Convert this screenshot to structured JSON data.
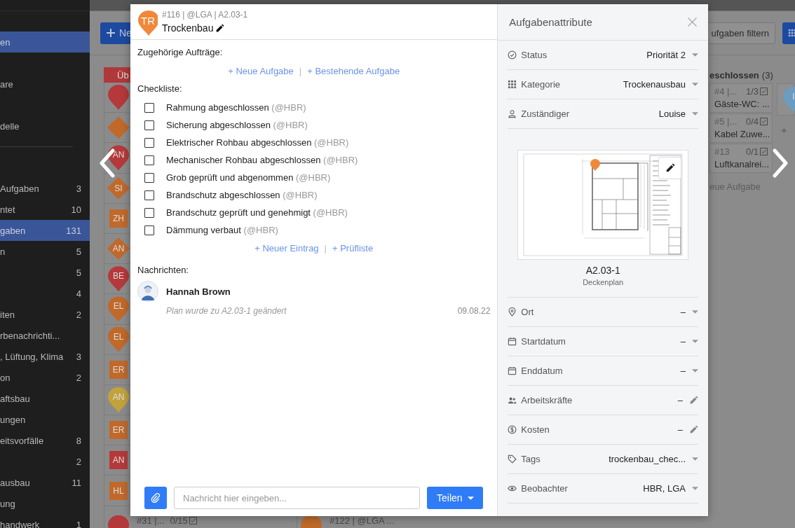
{
  "sidebar": {
    "nav_items": [
      {
        "label": "en",
        "selected": true
      },
      {
        "label": "are",
        "selected": false
      },
      {
        "label": "delle",
        "selected": false
      }
    ],
    "filter_items": [
      {
        "label": "Aufgaben",
        "count": "3",
        "selected": false
      },
      {
        "label": "ntet",
        "count": "10",
        "selected": false
      },
      {
        "label": "gaben",
        "count": "131",
        "selected": true
      },
      {
        "label": "n",
        "count": "5",
        "selected": false
      },
      {
        "count": "5",
        "selected": false
      },
      {
        "count": "4",
        "selected": false
      },
      {
        "label": "iten",
        "count": "2",
        "selected": false
      },
      {
        "label": "rbenachrichti...",
        "selected": false
      },
      {
        "label": ", Lüftung, Klima",
        "count": "3",
        "selected": false
      },
      {
        "label": "on",
        "count": "2",
        "selected": false
      },
      {
        "label": "aftsbau",
        "selected": false
      },
      {
        "label": "ungen",
        "selected": false
      },
      {
        "label": "eitsvorfälle",
        "count": "8",
        "selected": false
      },
      {
        "count": "2",
        "selected": false
      },
      {
        "label": "ausbau",
        "count": "11",
        "selected": false
      },
      {
        "label": "ung",
        "selected": false
      },
      {
        "label": "handwerk",
        "count": "1",
        "selected": false
      }
    ]
  },
  "toolbar": {
    "new_button": "Ne",
    "filter_button": "ufgaben filtern"
  },
  "board": {
    "left_column": {
      "header": "Üb",
      "rows": [
        {
          "kind": "pin",
          "color": "#b5393a"
        },
        {
          "kind": "diamond",
          "color": "#c0692a"
        },
        {
          "kind": "pin",
          "color": "#b5393a",
          "code": "AN"
        },
        {
          "kind": "diamond",
          "color": "#c0692a",
          "code": "SI"
        },
        {
          "kind": "square",
          "color": "#c0692a",
          "code": "ZH"
        },
        {
          "kind": "diamond",
          "color": "#c0692a",
          "code": "AN"
        },
        {
          "kind": "pin",
          "color": "#b5393a",
          "code": "BE"
        },
        {
          "kind": "pin",
          "color": "#c0692a",
          "code": "EL"
        },
        {
          "kind": "pin",
          "color": "#c0692a",
          "code": "EL"
        },
        {
          "kind": "square",
          "color": "#c0692a",
          "code": "ER"
        },
        {
          "kind": "pin",
          "color": "#c2a23c",
          "code": "AN"
        },
        {
          "kind": "square",
          "color": "#c0692a",
          "code": "ER"
        },
        {
          "kind": "square",
          "color": "#b5393a",
          "code": "AN"
        },
        {
          "kind": "square",
          "color": "#c0692a",
          "code": "HL"
        },
        {
          "kind": "pin",
          "color": "#b5393a",
          "meta": "#31 |...",
          "progress": "0/15"
        }
      ]
    },
    "middle_column": {
      "rows": [
        {
          "kind": "pin",
          "color": "#c0692a",
          "meta": "#122 | @LGA ..."
        }
      ]
    },
    "right_column": {
      "header": "eschlossen",
      "count": "(3)",
      "cards": [
        {
          "meta": "#4 |...",
          "progress": "1/3",
          "title": "Gäste-WC: ..."
        },
        {
          "meta": "#5 |...",
          "progress": "0/4",
          "title": "Kabel Zuwe..."
        },
        {
          "meta": "#13",
          "progress": "0/1",
          "title": "Luftkanalrei..."
        }
      ],
      "add_label": "eue Aufgabe"
    },
    "far_column": {
      "cards": [
        {
          "kind": "pin",
          "color": "#6c9cc0",
          "code": "I"
        }
      ],
      "add_label": "+"
    }
  },
  "task": {
    "avatar": "TR",
    "meta": "#116 | @LGA | A2.03-1",
    "title": "Trockenbau",
    "related": {
      "label": "Zugehörige Aufträge:",
      "links": [
        "+ Neue Aufgabe",
        "+ Bestehende Aufgabe"
      ],
      "separator": "|"
    },
    "checklist": {
      "label": "Checkliste:",
      "items": [
        {
          "text": "Rahmung abgeschlossen",
          "by": "(@HBR)",
          "checked": false
        },
        {
          "text": "Sicherung abgeschlossen",
          "by": "(@HBR)",
          "checked": false
        },
        {
          "text": "Elektrischer Rohbau abgeschlossen",
          "by": "(@HBR)",
          "checked": false
        },
        {
          "text": "Mechanischer Rohbau abgeschlossen",
          "by": "(@HBR)",
          "checked": false
        },
        {
          "text": "Grob geprüft und abgenommen",
          "by": "(@HBR)",
          "checked": false
        },
        {
          "text": "Brandschutz abgeschlossen",
          "by": "(@HBR)",
          "checked": false
        },
        {
          "text": "Brandschutz geprüft und genehmigt",
          "by": "(@HBR)",
          "checked": false
        },
        {
          "text": "Dämmung verbaut",
          "by": "(@HBR)",
          "checked": false
        }
      ],
      "links": [
        "+ Neuer Eintrag",
        "+ Prüfliste"
      ],
      "separator": "|"
    },
    "messages": {
      "label": "Nachrichten:",
      "items": [
        {
          "author": "Hannah Brown",
          "text": "Plan wurde zu A2.03-1 geändert",
          "date": "09.08.22"
        }
      ]
    },
    "composer": {
      "placeholder": "Nachricht hier eingeben...",
      "send_button": "Teilen"
    }
  },
  "attributes": {
    "title": "Aufgabenattribute",
    "fields": [
      {
        "label": "Status",
        "value": "Priorität 2",
        "kind": "select"
      },
      {
        "label": "Kategorie",
        "value": "Trockenausbau",
        "kind": "select"
      },
      {
        "label": "Zuständiger",
        "value": "Louise",
        "kind": "select"
      }
    ],
    "plan": {
      "name": "A2.03-1",
      "caption": "Deckenplan"
    },
    "more_fields": [
      {
        "label": "Ort",
        "value": "–",
        "kind": "select"
      },
      {
        "label": "Startdatum",
        "value": "–",
        "kind": "select"
      },
      {
        "label": "Enddatum",
        "value": "–",
        "kind": "select"
      },
      {
        "label": "Arbeitskräfte",
        "value": "–",
        "kind": "edit"
      },
      {
        "label": "Kosten",
        "value": "–",
        "kind": "edit"
      },
      {
        "label": "Tags",
        "value": "trockenbau_chec...",
        "kind": "select"
      },
      {
        "label": "Beobachter",
        "value": "HBR, LGA",
        "kind": "select"
      }
    ]
  }
}
